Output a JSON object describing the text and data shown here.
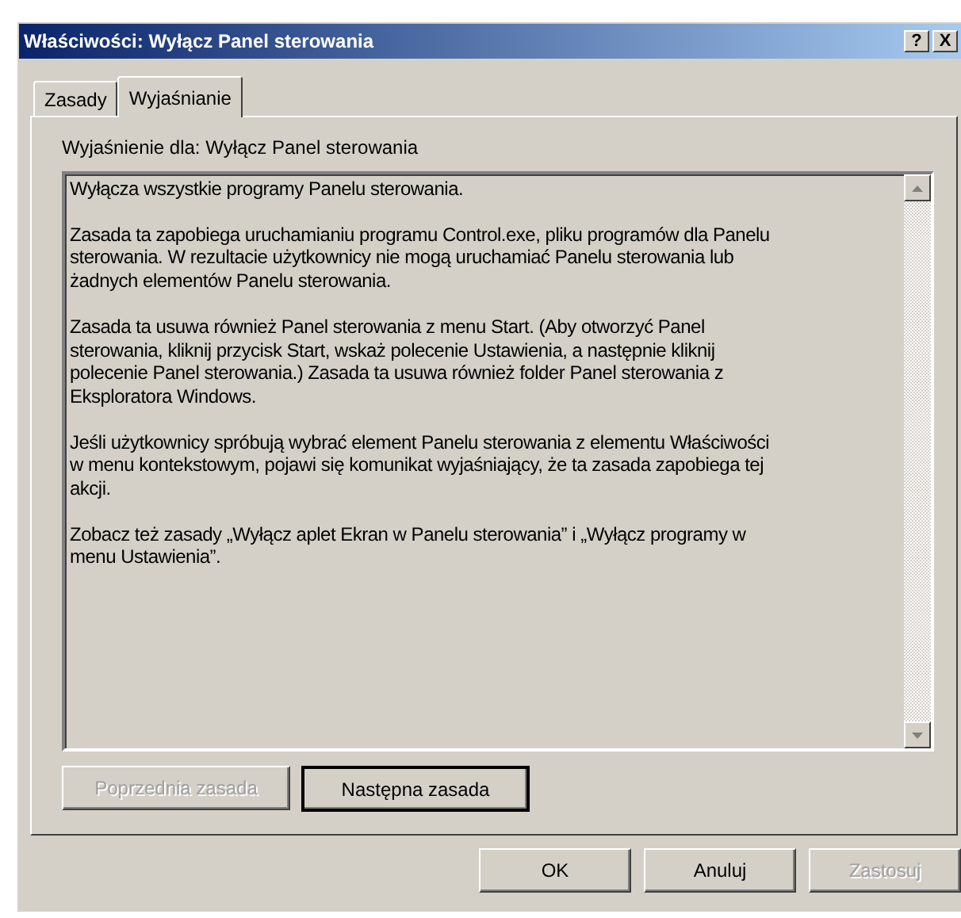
{
  "window": {
    "title": "Właściwości: Wyłącz Panel sterowania",
    "help": "?",
    "close": "X"
  },
  "tabs": [
    {
      "label": "Zasady",
      "selected": false
    },
    {
      "label": "Wyjaśnianie",
      "selected": true
    }
  ],
  "explain_label": "Wyjaśnienie dla:  Wyłącz Panel sterowania",
  "explanation": [
    [
      "Wyłącza wszystkie programy Panelu sterowania."
    ],
    [
      "Zasada ta zapobiega uruchamianiu programu Control.exe, pliku programów dla Panelu",
      "sterowania. W rezultacie użytkownicy nie mogą uruchamiać Panelu sterowania lub",
      "żadnych elementów Panelu sterowania."
    ],
    [
      "Zasada ta usuwa również Panel sterowania z menu Start. (Aby otworzyć Panel",
      "sterowania, kliknij przycisk Start, wskaż polecenie Ustawienia, a następnie kliknij",
      "polecenie Panel sterowania.) Zasada ta usuwa również folder Panel sterowania z",
      "Eksploratora Windows."
    ],
    [
      "Jeśli użytkownicy spróbują wybrać element Panelu sterowania z elementu Właściwości",
      "w menu kontekstowym, pojawi się komunikat wyjaśniający, że ta zasada zapobiega tej",
      "akcji."
    ],
    [
      "Zobacz też zasady „Wyłącz aplet Ekran w Panelu sterowania” i „Wyłącz programy w",
      "menu Ustawienia”."
    ]
  ],
  "nav_buttons": [
    {
      "label": "Poprzednia zasada",
      "disabled": true,
      "default": false
    },
    {
      "label": "Następna zasada",
      "disabled": false,
      "default": true
    }
  ],
  "dialog_buttons": [
    {
      "label": "OK",
      "disabled": false
    },
    {
      "label": "Anuluj",
      "disabled": false
    },
    {
      "label": "Zastosuj",
      "disabled": true
    }
  ]
}
